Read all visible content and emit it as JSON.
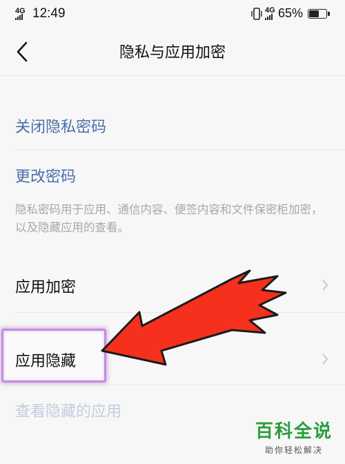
{
  "status_bar": {
    "signal_left": "4G",
    "time": "12:49",
    "vibrate_icon": "vibrate-icon",
    "signal_right": "4G",
    "battery": "65%",
    "battery_level": 0.65
  },
  "header": {
    "back_icon": "back-chevron-icon",
    "title": "隐私与应用加密"
  },
  "settings": {
    "close_privacy_password": "关闭隐私密码",
    "change_password": "更改密码",
    "description": "隐私密码用于应用、通信内容、便签内容和文件保密柜加密，以及隐藏应用的查看。",
    "app_encryption": "应用加密",
    "app_hide": "应用隐藏",
    "view_hidden_apps": "查看隐藏的应用"
  },
  "colors": {
    "link_blue": "#4a6ea8",
    "disabled_text": "#c2cde0",
    "annotation_red": "#f5301c",
    "highlight_purple": "#c58bdb",
    "watermark_green": "#2a9d3a"
  },
  "watermark": {
    "title": "百科全说",
    "subtitle": "助你轻松解决"
  }
}
